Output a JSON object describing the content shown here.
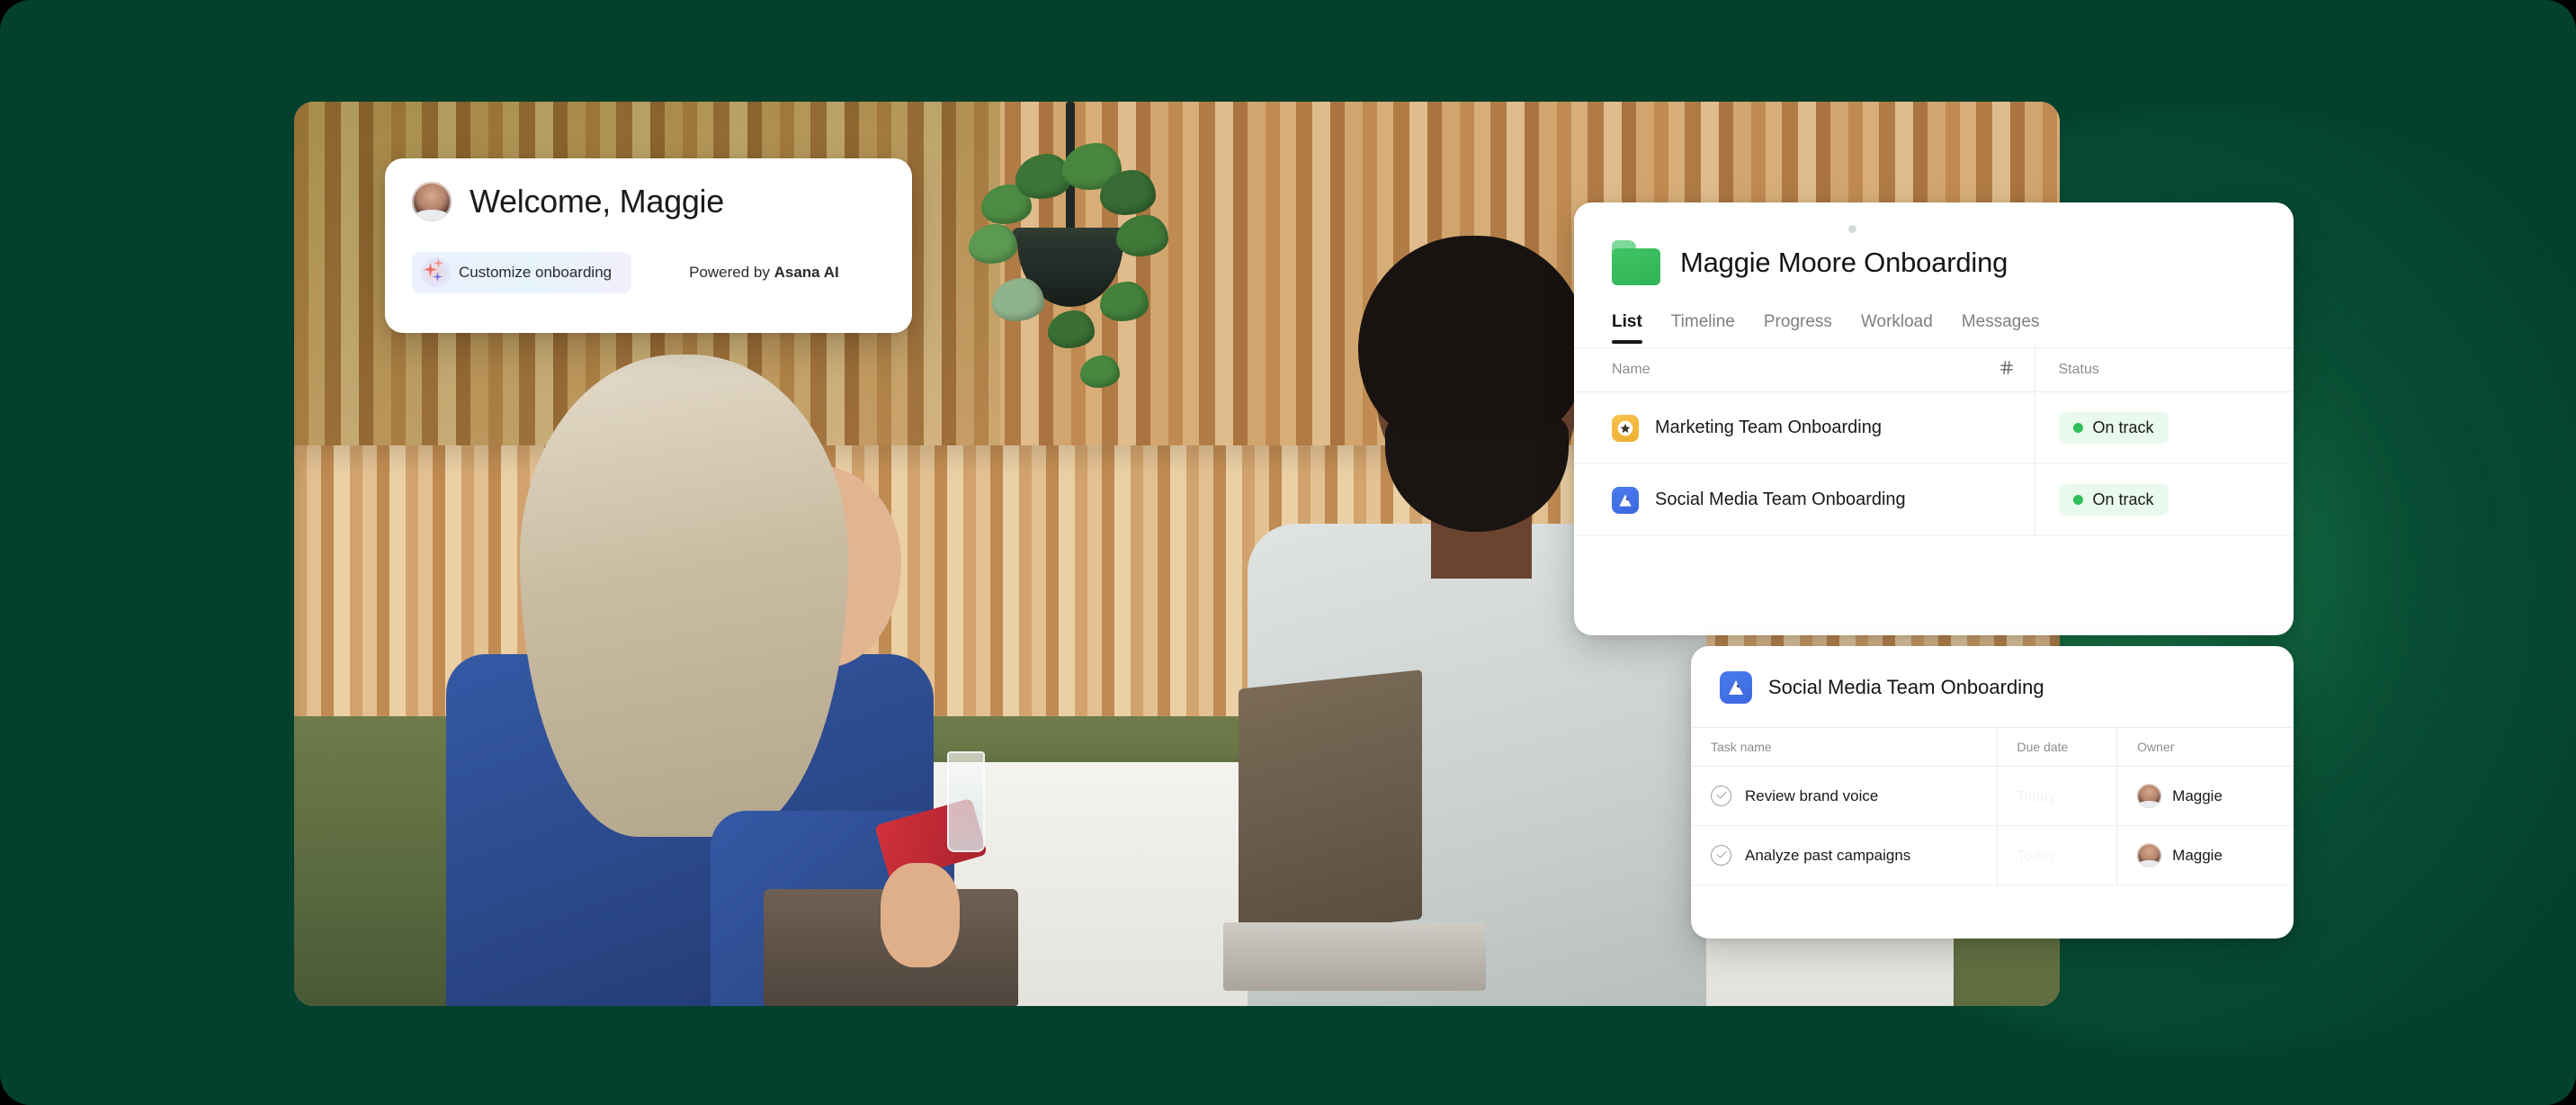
{
  "theme": {
    "background": "#03402E",
    "accent_green": "#2FBF5C",
    "card_background": "#FFFFFF",
    "text_primary": "#151515",
    "text_muted": "#8B8E90",
    "amber": "#F2B23C",
    "blue": "#4275E8"
  },
  "welcome_card": {
    "avatar_name": "user-avatar",
    "title": "Welcome, Maggie",
    "customize_label": "Customize onboarding",
    "sparkle_icon": "sparkle-icon",
    "powered_prefix": "Powered by ",
    "powered_brand": "Asana AI"
  },
  "project_card": {
    "folder_icon": "folder-icon",
    "title": "Maggie Moore Onboarding",
    "tabs": [
      {
        "label": "List",
        "active": true
      },
      {
        "label": "Timeline",
        "active": false
      },
      {
        "label": "Progress",
        "active": false
      },
      {
        "label": "Workload",
        "active": false
      },
      {
        "label": "Messages",
        "active": false
      }
    ],
    "columns": {
      "name": "Name",
      "name_icon": "hash-icon",
      "status": "Status"
    },
    "rows": [
      {
        "icon": "star-icon",
        "icon_style": "amber",
        "name": "Marketing Team Onboarding",
        "status": "On track"
      },
      {
        "icon": "mountain-icon",
        "icon_style": "blue",
        "name": "Social Media Team Onboarding",
        "status": "On track"
      }
    ]
  },
  "task_card": {
    "icon": "mountain-icon",
    "title": "Social Media Team Onboarding",
    "columns": {
      "task_name": "Task name",
      "due_date": "Due date",
      "owner": "Owner"
    },
    "rows": [
      {
        "check_icon": "check-circle-icon",
        "task_name": "Review brand voice",
        "due_date": "Today",
        "owner": "Maggie"
      },
      {
        "check_icon": "check-circle-icon",
        "task_name": "Analyze past campaigns",
        "due_date": "Today",
        "owner": "Maggie"
      }
    ]
  }
}
